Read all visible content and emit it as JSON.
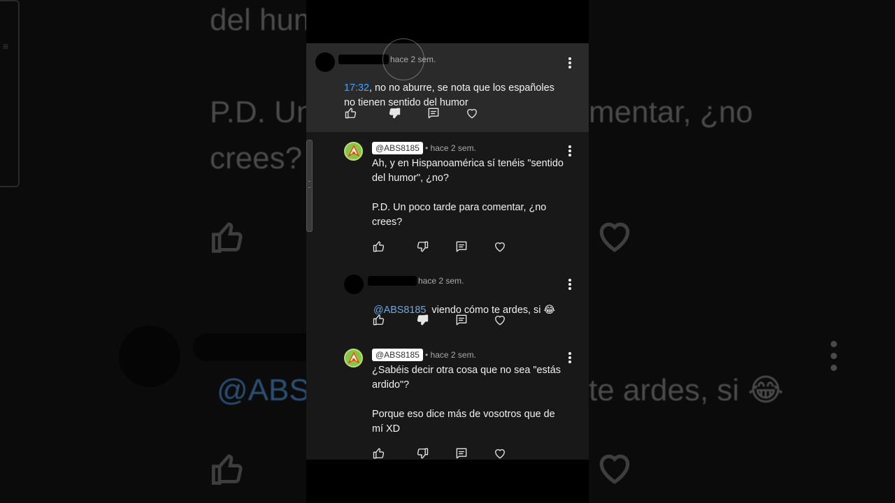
{
  "background": {
    "top_text": "del humor",
    "pd_line1_left": "P.D. Un",
    "pd_line1_right": "mentar, ¿no",
    "pd_line2_left": "crees?",
    "mention_left": "@ABS",
    "reply_right": "te ardes, si 😂"
  },
  "comments": [
    {
      "time_ago": "hace 2 sem.",
      "timestamp_link": "17:32",
      "text": ", no no aburre, se nota que los españoles\nno tienen sentido del humor"
    },
    {
      "handle": "@ABS8185",
      "time_ago": "• hace 2 sem.",
      "text": "Ah, y en Hispanoamérica sí tenéis \"sentido\ndel humor\", ¿no?\n\nP.D. Un poco tarde para comentar, ¿no\ncrees?"
    },
    {
      "time_ago": "hace 2 sem.",
      "mention": "@ABS8185",
      "text": "viendo cómo te ardes, si 😂"
    },
    {
      "handle": "@ABS8185",
      "time_ago": "• hace 2 sem.",
      "text": "¿Sabéis decir otra cosa que no sea \"estás\nardido\"?\n\nPorque eso dice más de vosotros que de\nmí XD"
    }
  ],
  "icons": {
    "like": "thumbs-up-icon",
    "dislike": "thumbs-down-icon",
    "reply": "reply-icon",
    "heart": "heart-icon",
    "menu": "more-vert-icon"
  },
  "colors": {
    "panel_bg": "#181818",
    "highlight_bg": "#2a2a2a",
    "link": "#3ea6ff",
    "avatar_green": "#8bc34a"
  }
}
